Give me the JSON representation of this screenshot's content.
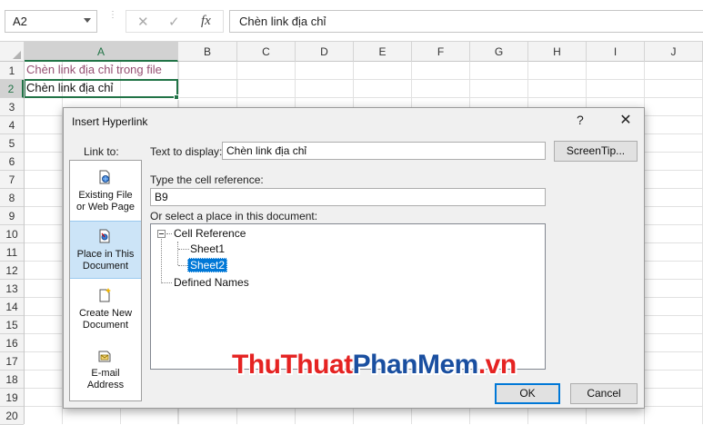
{
  "formula_bar": {
    "name_box": "A2",
    "cancel_icon": "✕",
    "enter_icon": "✓",
    "fx_icon": "fx",
    "formula": "Chèn link địa chỉ"
  },
  "grid": {
    "columns": [
      "A",
      "B",
      "C",
      "D",
      "E",
      "F",
      "G",
      "H",
      "I",
      "J"
    ],
    "rows": [
      "1",
      "2",
      "3",
      "4",
      "5",
      "6",
      "7",
      "8",
      "9",
      "10",
      "11",
      "12",
      "13",
      "14",
      "15",
      "16",
      "17",
      "18",
      "19",
      "20"
    ],
    "cell_a1": "Chèn link địa chỉ trong file",
    "cell_a2": "Chèn link địa chỉ"
  },
  "dialog": {
    "title": "Insert Hyperlink",
    "help": "?",
    "close": "✕",
    "link_to_label": "Link to:",
    "link_to_items": [
      {
        "line1": "Existing File",
        "line2": "or Web Page",
        "icon": "existing-file-icon"
      },
      {
        "line1": "Place in This",
        "line2": "Document",
        "icon": "place-in-document-icon"
      },
      {
        "line1": "Create New",
        "line2": "Document",
        "icon": "new-document-icon"
      },
      {
        "line1": "E-mail",
        "line2": "Address",
        "icon": "email-icon"
      }
    ],
    "text_to_display_label": "Text to display:",
    "text_to_display_value": "Chèn link địa chỉ",
    "screentip_button": "ScreenTip...",
    "cell_reference_label": "Type the cell reference:",
    "cell_reference_value": "B9",
    "place_label": "Or select a place in this document:",
    "tree": {
      "root": "Cell Reference",
      "sheet1": "Sheet1",
      "sheet2": "Sheet2",
      "defined_names": "Defined Names"
    },
    "ok_button": "OK",
    "cancel_button": "Cancel"
  },
  "watermark": {
    "part1": "ThuThuat",
    "part2": "PhanMem",
    "part3": ".vn"
  },
  "colors": {
    "excel_green": "#217346",
    "visited_link": "#954f72",
    "selection_blue": "#0078d7"
  }
}
